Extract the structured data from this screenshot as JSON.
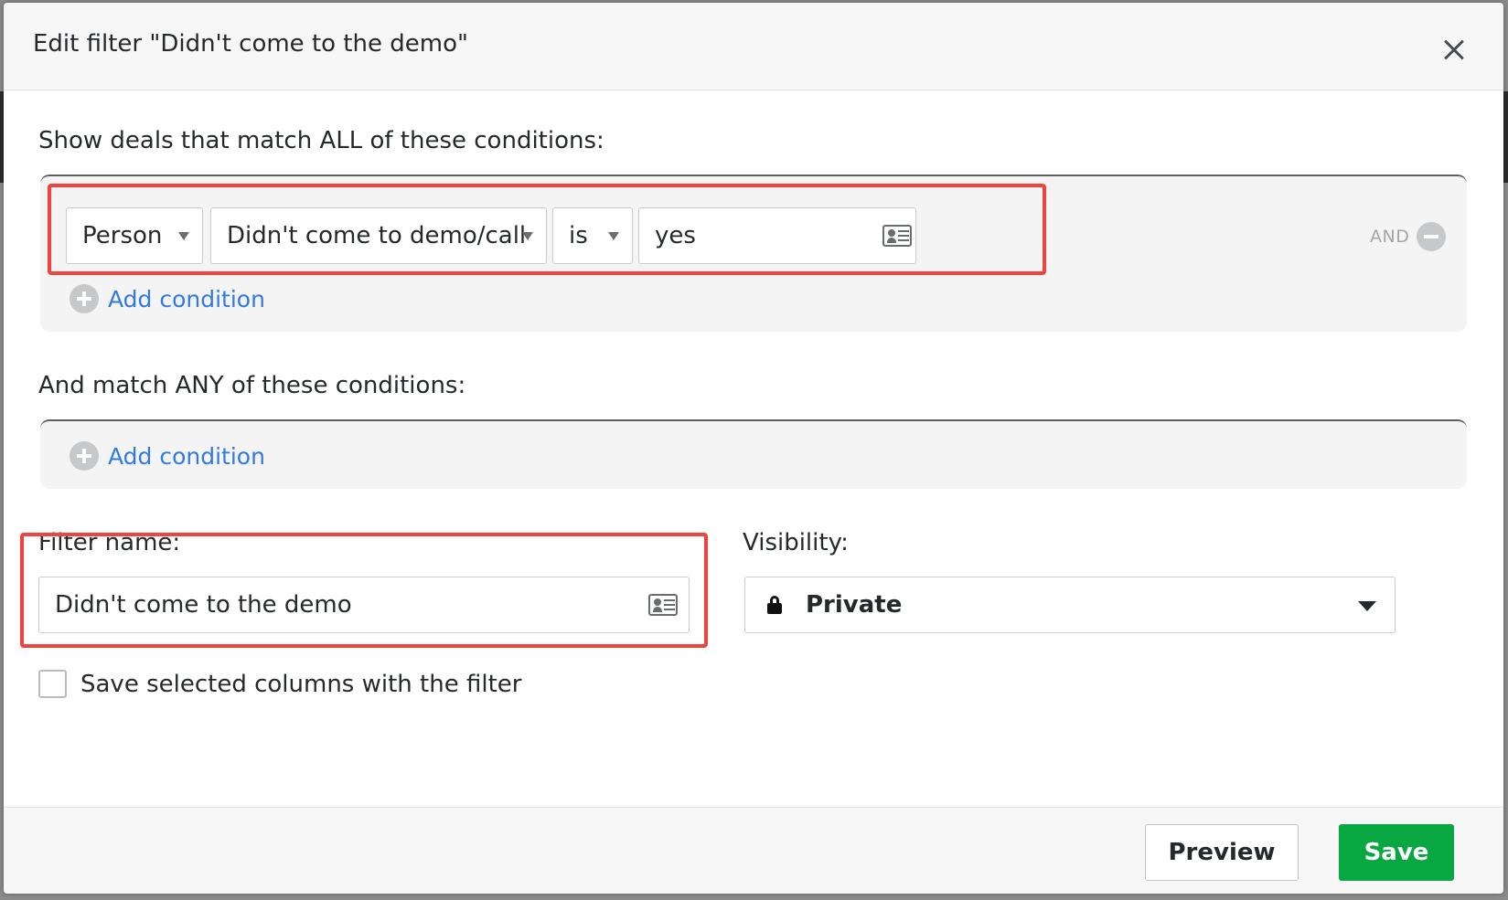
{
  "modal": {
    "title": "Edit filter \"Didn't come to the demo\""
  },
  "all_conditions": {
    "label": "Show deals that match ALL of these conditions:",
    "row": {
      "entity": "Person",
      "field": "Didn't come to demo/call",
      "operator": "is",
      "value": "yes",
      "and_label": "AND"
    },
    "add_condition_label": "Add condition"
  },
  "any_conditions": {
    "label": "And match ANY of these conditions:",
    "add_condition_label": "Add condition"
  },
  "filter_name": {
    "label": "Filter name:",
    "value": "Didn't come to the demo"
  },
  "visibility": {
    "label": "Visibility:",
    "value": "Private"
  },
  "save_columns": {
    "label": "Save selected columns with the filter",
    "checked": false
  },
  "footer": {
    "preview_label": "Preview",
    "save_label": "Save"
  },
  "colors": {
    "accent_link": "#317ae2",
    "save_green": "#08a742",
    "highlight_red": "#f0433f"
  }
}
